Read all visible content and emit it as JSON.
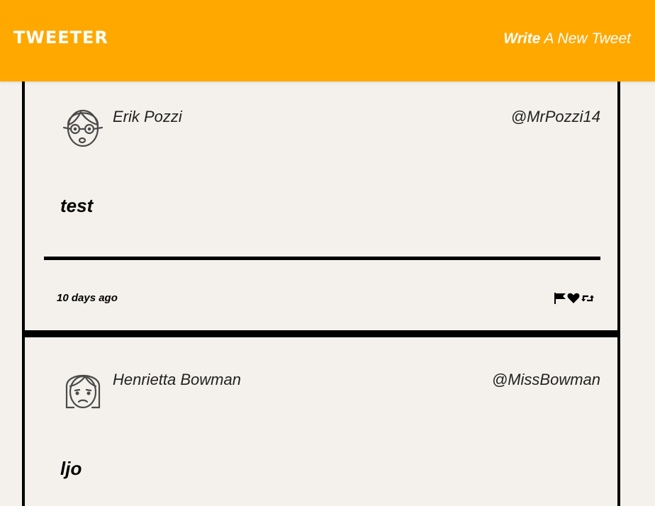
{
  "header": {
    "logo": "TWEETER",
    "write_bold": "Write",
    "write_rest": " A New Tweet"
  },
  "tweets": [
    {
      "name": "Erik Pozzi",
      "handle": "@MrPozzi14",
      "content": "test",
      "time": "10 days ago",
      "avatar_icon": "face-glasses-icon"
    },
    {
      "name": "Henrietta Bowman",
      "handle": "@MissBowman",
      "content": "ljo",
      "avatar_icon": "face-woman-frown-icon"
    }
  ],
  "actions": [
    "flag-icon",
    "heart-icon",
    "retweet-icon"
  ],
  "colors": {
    "header": "#ffa800",
    "background": "#f4f1ec",
    "text": "#000000"
  }
}
